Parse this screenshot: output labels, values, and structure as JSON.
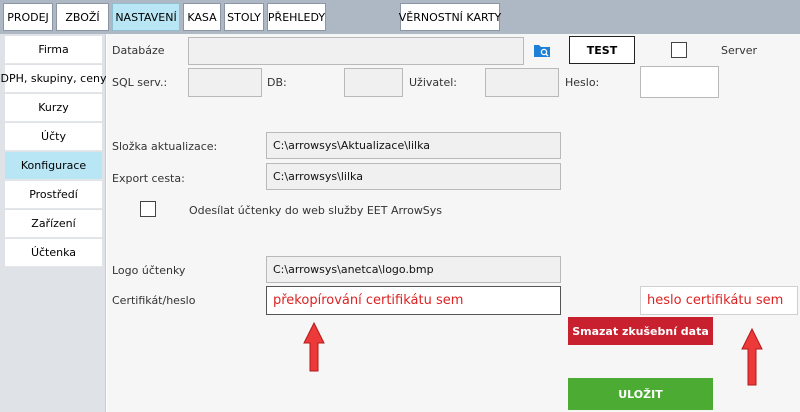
{
  "top_tabs": [
    {
      "label": "PRODEJ",
      "active": false
    },
    {
      "label": "ZBOŽÍ",
      "active": false
    },
    {
      "label": "NASTAVENÍ",
      "active": true
    },
    {
      "label": "KASA",
      "active": false
    },
    {
      "label": "STOLY",
      "active": false
    },
    {
      "label": "PŘEHLEDY",
      "active": false
    },
    {
      "label": "VĚRNOSTNÍ KARTY",
      "active": false
    }
  ],
  "sidebar": {
    "items": [
      {
        "label": "Firma",
        "active": false
      },
      {
        "label": "DPH, skupiny, ceny",
        "active": false
      },
      {
        "label": "Kurzy",
        "active": false
      },
      {
        "label": "Účty",
        "active": false
      },
      {
        "label": "Konfigurace",
        "active": true
      },
      {
        "label": "Prostředí",
        "active": false
      },
      {
        "label": "Zařízení",
        "active": false
      },
      {
        "label": "Účtenka",
        "active": false
      }
    ]
  },
  "config": {
    "database": {
      "label": "Databáze",
      "value": ""
    },
    "folder_icon": "folder-search-icon",
    "test_label": "TEST",
    "server": {
      "label": "Server",
      "checked": false
    },
    "sql_server": {
      "label": "SQL serv.:",
      "value": ""
    },
    "db": {
      "label": "DB:",
      "value": ""
    },
    "user": {
      "label": "Uživatel:",
      "value": ""
    },
    "password": {
      "label": "Heslo:",
      "value": ""
    },
    "update_folder": {
      "label": "Složka aktualizace:",
      "value": "C:\\arrowsys\\Aktualizace\\lilka"
    },
    "export_path": {
      "label": "Export cesta:",
      "value": "C:\\arrowsys\\lilka"
    },
    "eet": {
      "label": "Odesílat účtenky do web služby EET ArrowSys",
      "checked": false
    },
    "receipt_logo": {
      "label": "Logo účtenky",
      "value": "C:\\arrowsys\\anetca\\logo.bmp"
    },
    "certificate": {
      "label": "Certifikát/heslo",
      "value": "překopírování certifikátu sem"
    },
    "cert_password": {
      "value": "heslo certifikátu sem"
    },
    "delete_label": "Smazat zkušební data",
    "save_label": "ULOŽIT",
    "arrow_icon": "red-up-arrow-icon"
  },
  "colors": {
    "accent_active": "#b8e6f5",
    "delete_button": "#c8202f",
    "save_button": "#4bab33",
    "annotation_red": "#dd2222",
    "folder_icon": "#1e7fd6"
  }
}
